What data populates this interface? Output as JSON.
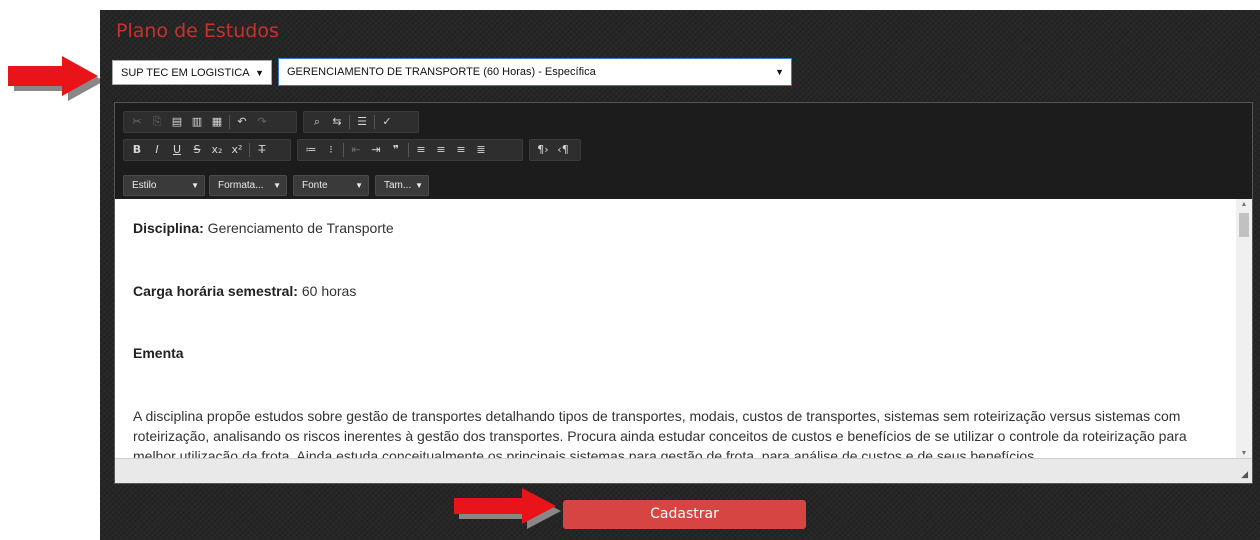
{
  "page": {
    "title": "Plano de Estudos"
  },
  "filters": {
    "course_select": "SUP TEC EM LOGISTICA",
    "discipline_select": "GERENCIAMENTO DE TRANSPORTE (60 Horas) - Específica"
  },
  "editor": {
    "toolbar_combos": {
      "style": "Estilo",
      "format": "Formata...",
      "font": "Fonte",
      "size": "Tam..."
    },
    "content": {
      "discipline_label": "Disciplina:",
      "discipline_value": " Gerenciamento de Transporte",
      "workload_label": "Carga horária semestral:",
      "workload_value": " 60 horas",
      "summary_heading": "Ementa",
      "summary_text": "A disciplina propõe estudos sobre gestão de transportes detalhando tipos de transportes, modais, custos de transportes, sistemas sem roteirização versus sistemas com roteirização, analisando os riscos inerentes à gestão dos transportes. Procura ainda estudar conceitos de custos e benefícios de se utilizar o controle da roteirização para melhor utilização da frota. Ainda estuda conceitualmente os principais sistemas para gestão de frota, para análise de custos e de seus benefícios."
    }
  },
  "actions": {
    "submit_label": "Cadastrar"
  },
  "colors": {
    "panel_bg": "#262626",
    "title": "#c8312d",
    "submit": "#d64541",
    "arrow": "#e8141a"
  }
}
